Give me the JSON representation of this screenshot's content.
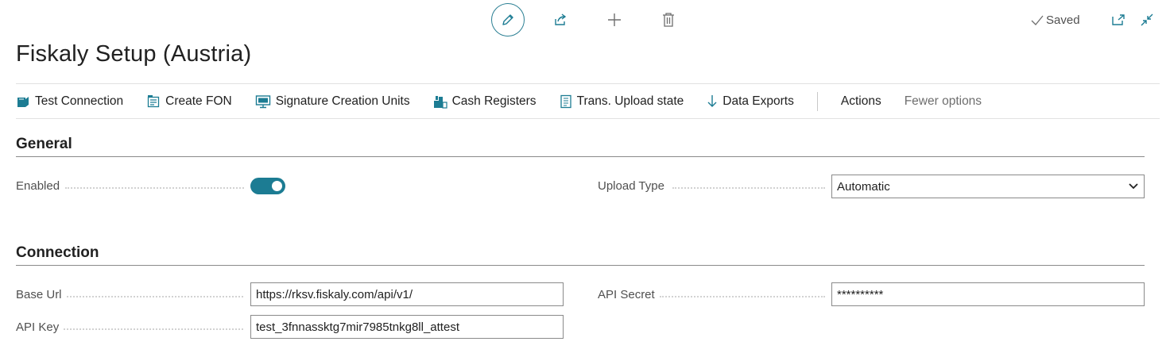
{
  "topbar": {
    "edit_icon": "pencil-icon",
    "share_icon": "share-icon",
    "new_icon": "plus-icon",
    "delete_icon": "trash-icon",
    "saved_label": "Saved",
    "open_new_window_icon": "open-in-new-window-icon",
    "collapse_icon": "collapse-icon"
  },
  "page": {
    "title": "Fiskaly Setup (Austria)"
  },
  "actions": {
    "test_connection": "Test Connection",
    "create_fon": "Create FON",
    "signature_creation_units": "Signature Creation Units",
    "cash_registers": "Cash Registers",
    "trans_upload_state": "Trans. Upload state",
    "data_exports": "Data Exports",
    "actions_menu": "Actions",
    "fewer_options": "Fewer options"
  },
  "general": {
    "title": "General",
    "enabled_label": "Enabled",
    "enabled_value": true,
    "upload_type_label": "Upload Type",
    "upload_type_value": "Automatic"
  },
  "connection": {
    "title": "Connection",
    "base_url_label": "Base Url",
    "base_url_value": "https://rksv.fiskaly.com/api/v1/",
    "api_key_label": "API Key",
    "api_key_value": "test_3fnnassktg7mir7985tnkg8ll_attest",
    "api_secret_label": "API Secret",
    "api_secret_value": "**********"
  },
  "colors": {
    "accent": "#1c7c93",
    "text": "#212121",
    "label": "#505050"
  }
}
